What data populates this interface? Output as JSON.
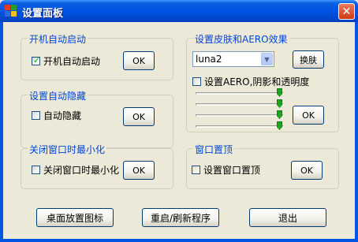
{
  "window": {
    "title": "设置面板"
  },
  "icons": {
    "app": "app-grid-icon",
    "close": "close-icon",
    "dropdown": "chevron-down-icon",
    "check": "checkmark-icon"
  },
  "colors": {
    "titlebar": "#0054e3",
    "group_title": "#0046d5",
    "client_bg": "#ece9d8",
    "slider_thumb": "#21a121"
  },
  "autostart": {
    "title": "开机自动启动",
    "checkbox_label": "开机自动启动",
    "checked": true,
    "ok": "OK"
  },
  "autohide": {
    "title": "设置自动隐藏",
    "checkbox_label": "自动隐藏",
    "checked": false,
    "ok": "OK"
  },
  "minimize": {
    "title": "关闭窗口时最小化",
    "checkbox_label": "关闭窗口时最小化",
    "checked": false,
    "ok": "OK"
  },
  "skin": {
    "title": "设置皮肤和AERO效果",
    "selected": "luna2",
    "change_button": "换肤",
    "aero_label": "设置AERO,阴影和透明度",
    "aero_checked": false,
    "sliders": [
      1,
      1,
      1,
      1
    ],
    "ok": "OK"
  },
  "topmost": {
    "title": "窗口置顶",
    "checkbox_label": "设置窗口置顶",
    "checked": false,
    "ok": "OK"
  },
  "bottom": {
    "desktop_icon": "桌面放置图标",
    "restart": "重启/刷新程序",
    "exit": "退出"
  }
}
